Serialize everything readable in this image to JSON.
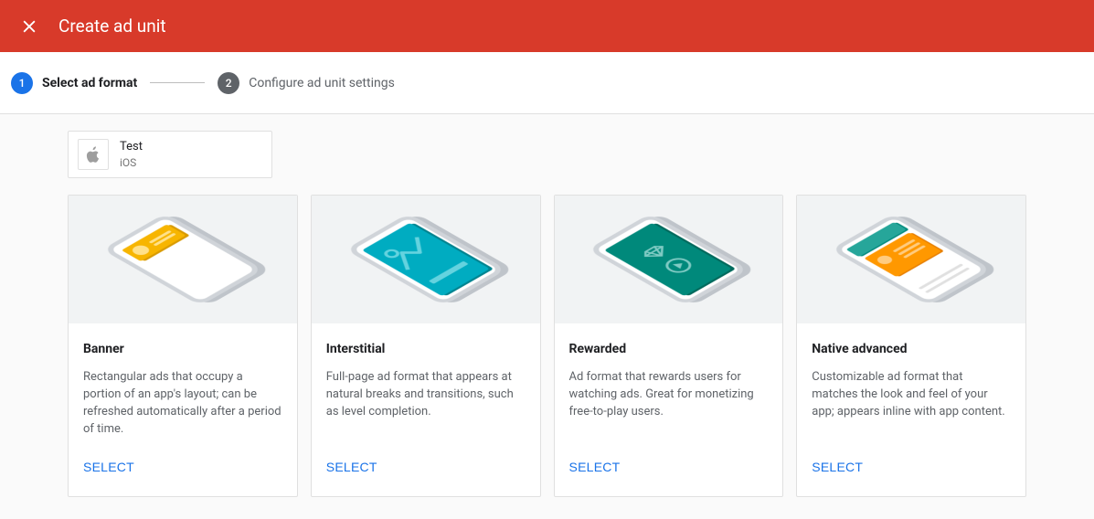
{
  "header": {
    "title": "Create ad unit"
  },
  "stepper": {
    "step1": {
      "num": "1",
      "label": "Select ad format"
    },
    "step2": {
      "num": "2",
      "label": "Configure ad unit settings"
    }
  },
  "app": {
    "name": "Test",
    "platform": "iOS"
  },
  "formats": [
    {
      "key": "banner",
      "title": "Banner",
      "desc": "Rectangular ads that occupy a portion of an app's layout; can be refreshed automatically after a period of time.",
      "action": "SELECT"
    },
    {
      "key": "interstitial",
      "title": "Interstitial",
      "desc": "Full-page ad format that appears at natural breaks and transitions, such as level completion.",
      "action": "SELECT"
    },
    {
      "key": "rewarded",
      "title": "Rewarded",
      "desc": "Ad format that rewards users for watching ads. Great for monetizing free-to-play users.",
      "action": "SELECT"
    },
    {
      "key": "native",
      "title": "Native advanced",
      "desc": "Customizable ad format that matches the look and feel of your app; appears inline with app content.",
      "action": "SELECT"
    }
  ]
}
